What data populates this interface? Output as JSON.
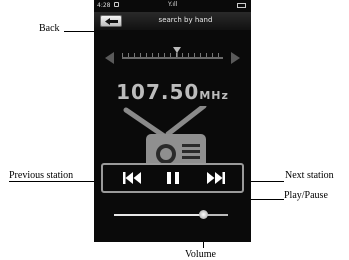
{
  "status_bar": {
    "time": "4:28",
    "signal": "Y.ıll"
  },
  "header": {
    "title": "search by hand"
  },
  "tuner": {
    "frequency": "107.50",
    "unit": "MHz"
  },
  "volume": {
    "level": 0.78
  },
  "callouts": {
    "back": "Back",
    "previous_station": "Previous station",
    "next_station": "Next  station",
    "play_pause": "Play/Pause",
    "volume": "Volume"
  }
}
